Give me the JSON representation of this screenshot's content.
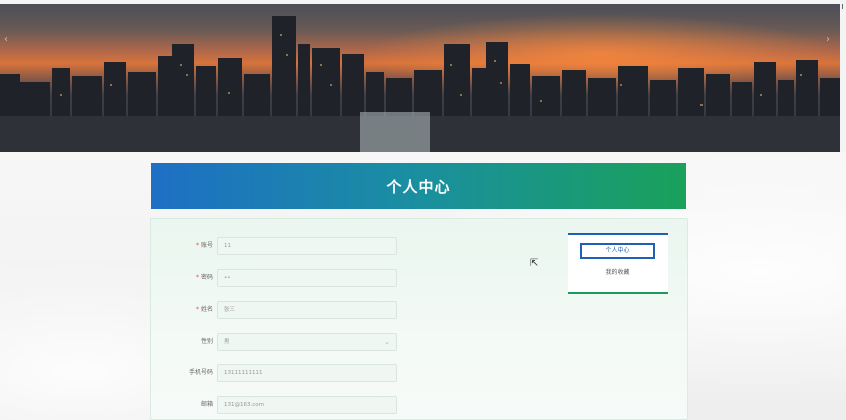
{
  "banner": {
    "prev_icon": "chevron-left-icon",
    "next_icon": "chevron-right-icon",
    "prev_glyph": "‹",
    "next_glyph": "›"
  },
  "page": {
    "title": "个人中心"
  },
  "form": {
    "fields": [
      {
        "label": "账号",
        "required": true,
        "value": "11"
      },
      {
        "label": "密码",
        "required": true,
        "value": "••"
      },
      {
        "label": "姓名",
        "required": true,
        "value": "张三"
      },
      {
        "label": "性别",
        "required": false,
        "value": "男",
        "select": true
      },
      {
        "label": "手机号码",
        "required": false,
        "value": "13111111111"
      },
      {
        "label": "邮箱",
        "required": false,
        "value": "131@163.com"
      }
    ]
  },
  "side_menu": {
    "active_label": "个人中心",
    "second_label": "我的收藏"
  },
  "colors": {
    "title_gradient_start": "#1e6fc5",
    "title_gradient_end": "#1aa15a",
    "required": "#e24b4b"
  }
}
